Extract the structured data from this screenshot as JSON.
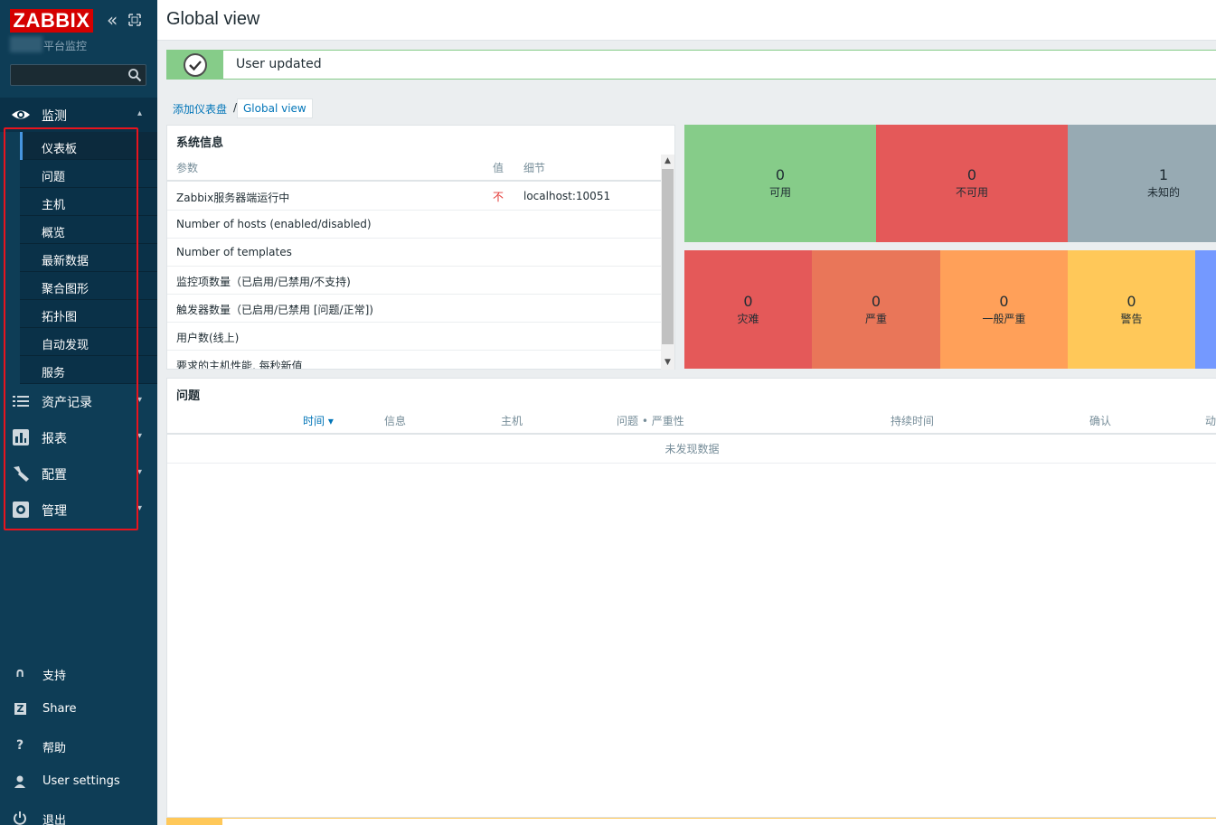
{
  "sidebar": {
    "logo": "ZABBIX",
    "server_name": "平台监控",
    "search_placeholder": "",
    "sections": [
      {
        "label": "监测",
        "icon": "eye-icon",
        "expanded": true
      },
      {
        "label": "资产记录",
        "icon": "list-icon"
      },
      {
        "label": "报表",
        "icon": "chart-icon"
      },
      {
        "label": "配置",
        "icon": "wrench-icon"
      },
      {
        "label": "管理",
        "icon": "gear-icon"
      }
    ],
    "monitoring_items": [
      {
        "label": "仪表板",
        "active": true
      },
      {
        "label": "问题"
      },
      {
        "label": "主机"
      },
      {
        "label": "概览"
      },
      {
        "label": "最新数据"
      },
      {
        "label": "聚合图形"
      },
      {
        "label": "拓扑图"
      },
      {
        "label": "自动发现"
      },
      {
        "label": "服务"
      }
    ],
    "bottom_items": [
      {
        "label": "支持",
        "icon": "headset-icon"
      },
      {
        "label": "Share",
        "icon": "share-icon"
      },
      {
        "label": "帮助",
        "icon": "help-icon"
      },
      {
        "label": "User settings",
        "icon": "user-icon"
      },
      {
        "label": "退出",
        "icon": "power-icon"
      }
    ]
  },
  "header": {
    "title": "Global view"
  },
  "message": {
    "text": "User updated",
    "status": "success"
  },
  "breadcrumb": {
    "parent": "添加仪表盘",
    "separator": "/",
    "current": "Global view"
  },
  "system_info": {
    "title": "系统信息",
    "columns": [
      "参数",
      "值",
      "细节"
    ],
    "rows": [
      {
        "param": "Zabbix服务器端运行中",
        "value": "不",
        "detail": "localhost:10051"
      },
      {
        "param": "Number of hosts (enabled/disabled)",
        "value": "",
        "detail": ""
      },
      {
        "param": "Number of templates",
        "value": "",
        "detail": ""
      },
      {
        "param": "监控项数量（已启用/已禁用/不支持)",
        "value": "",
        "detail": ""
      },
      {
        "param": "触发器数量（已启用/已禁用 [问题/正常])",
        "value": "",
        "detail": ""
      },
      {
        "param": "用户数(线上)",
        "value": "",
        "detail": ""
      },
      {
        "param": "要求的主机性能, 每秒新值",
        "value": "",
        "detail": ""
      }
    ]
  },
  "host_availability": [
    {
      "count": "0",
      "label": "可用",
      "color": "#86cc89"
    },
    {
      "count": "0",
      "label": "不可用",
      "color": "#e45959"
    },
    {
      "count": "1",
      "label": "未知的",
      "color": "#97aab3"
    }
  ],
  "problems_by_severity": [
    {
      "count": "0",
      "label": "灾难",
      "color": "#e45959"
    },
    {
      "count": "0",
      "label": "严重",
      "color": "#e97659"
    },
    {
      "count": "0",
      "label": "一般严重",
      "color": "#ffa059"
    },
    {
      "count": "0",
      "label": "警告",
      "color": "#ffc859"
    },
    {
      "count": "",
      "label": "",
      "color": "#7499ff"
    }
  ],
  "problems": {
    "title": "问题",
    "columns": [
      "时间 ▾",
      "信息",
      "主机",
      "问题 • 严重性",
      "持续时间",
      "确认",
      "动"
    ],
    "empty_text": "未发现数据"
  }
}
